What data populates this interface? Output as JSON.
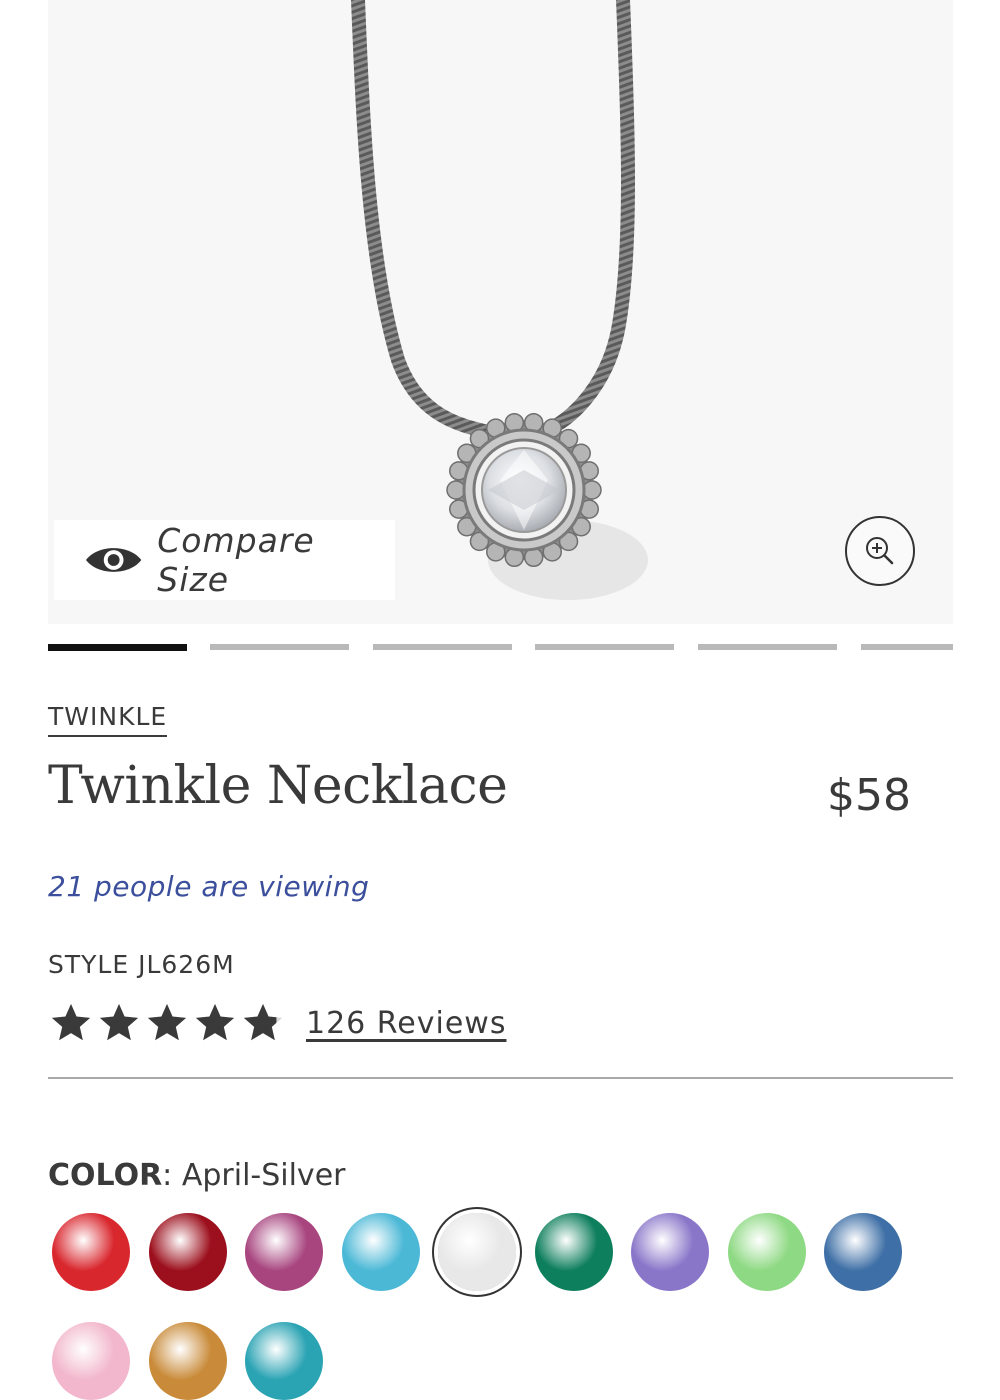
{
  "gallery": {
    "compare_label": "Compare Size",
    "slide_count": 6,
    "active_slide": 1
  },
  "product": {
    "collection": "TWINKLE",
    "title": "Twinkle Necklace",
    "price": "$58",
    "viewing": "21 people are viewing",
    "style": "STYLE JL626M",
    "rating": 4.8,
    "reviews": "126 Reviews"
  },
  "color": {
    "key": "COLOR",
    "value": "April-Silver",
    "swatches": [
      {
        "name": "red",
        "color": "#d9272e"
      },
      {
        "name": "garnet",
        "color": "#9c0f1c"
      },
      {
        "name": "amethyst",
        "color": "#a8457f"
      },
      {
        "name": "aquamarine",
        "color": "#4bb8d6"
      },
      {
        "name": "crystal",
        "color": "#e8e8e8",
        "selected": true
      },
      {
        "name": "emerald",
        "color": "#0e7f5c"
      },
      {
        "name": "tanzanite",
        "color": "#8a76c9"
      },
      {
        "name": "peridot",
        "color": "#8ed983"
      },
      {
        "name": "sapphire",
        "color": "#3e6fa6"
      },
      {
        "name": "pink",
        "color": "#f2b7cc"
      },
      {
        "name": "topaz",
        "color": "#c98b3a"
      },
      {
        "name": "zircon",
        "color": "#2aa3b3"
      }
    ]
  },
  "colors": {
    "link_blue": "#3b4f9c",
    "text": "#3a3a3a",
    "slide_active": "#111111",
    "slide_inactive": "#b9b9b9"
  },
  "icons": {
    "compare": "eye-icon",
    "zoom": "zoom-in-icon",
    "star": "star-icon"
  }
}
